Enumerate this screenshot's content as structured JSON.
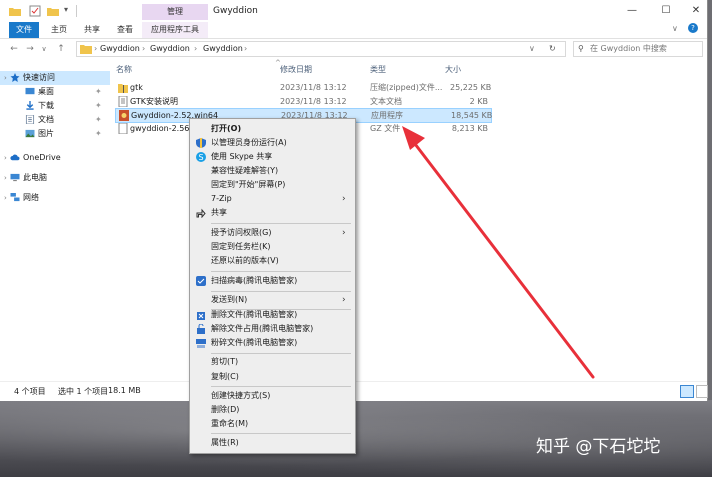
{
  "window": {
    "title": "Gwyddion",
    "context_tab_group": "管理",
    "ribbon_tabs": [
      "文件",
      "主页",
      "共享",
      "查看",
      "应用程序工具"
    ],
    "controls": {
      "minimize": "—",
      "maximize": "☐",
      "close": "✕"
    }
  },
  "address": {
    "breadcrumb": [
      "Gwyddion",
      "Gwyddion",
      "Gwyddion"
    ],
    "search_placeholder": "在 Gwyddion 中搜索"
  },
  "sidebar": {
    "items": [
      {
        "label": "快速访问",
        "icon": "star-icon",
        "pinned": false,
        "selected": true
      },
      {
        "label": "桌面",
        "icon": "desktop-icon",
        "pinned": true
      },
      {
        "label": "下载",
        "icon": "download-icon",
        "pinned": true
      },
      {
        "label": "文档",
        "icon": "document-icon",
        "pinned": true
      },
      {
        "label": "图片",
        "icon": "picture-icon",
        "pinned": true
      },
      {
        "label": "OneDrive",
        "icon": "cloud-icon"
      },
      {
        "label": "此电脑",
        "icon": "computer-icon"
      },
      {
        "label": "网络",
        "icon": "network-icon"
      }
    ]
  },
  "columns": {
    "name": "名称",
    "date": "修改日期",
    "type": "类型",
    "size": "大小"
  },
  "files": [
    {
      "name": "gtk",
      "date": "2023/11/8 13:12",
      "type": "压缩(zipped)文件...",
      "size": "25,225 KB",
      "icon": "zip-folder-icon"
    },
    {
      "name": "GTK安装说明",
      "date": "2023/11/8 13:12",
      "type": "文本文档",
      "size": "2 KB",
      "icon": "text-file-icon"
    },
    {
      "name": "Gwyddion-2.52.win64",
      "date": "2023/11/8 13:12",
      "type": "应用程序",
      "size": "18,545 KB",
      "icon": "installer-icon",
      "selected": true
    },
    {
      "name": "gwyddion-2.56.t",
      "date": "",
      "type": "GZ 文件",
      "size": "8,213 KB",
      "icon": "file-icon"
    }
  ],
  "status": {
    "count": "4 个项目",
    "selection": "选中 1 个项目",
    "size": "18.1 MB"
  },
  "context_menu": {
    "items": [
      {
        "label": "打开(O)",
        "bold": true
      },
      {
        "label": "以管理员身份运行(A)",
        "icon": "shield-icon"
      },
      {
        "label": "使用 Skype 共享",
        "icon": "skype-icon"
      },
      {
        "label": "兼容性疑难解答(Y)"
      },
      {
        "label": "固定到\"开始\"屏幕(P)"
      },
      {
        "label": "7-Zip",
        "submenu": true
      },
      {
        "label": "共享",
        "icon": "share-icon"
      },
      {
        "sep": true
      },
      {
        "label": "授予访问权限(G)",
        "submenu": true
      },
      {
        "label": "固定到任务栏(K)"
      },
      {
        "label": "还原以前的版本(V)"
      },
      {
        "sep": true
      },
      {
        "label": "扫描病毒(腾讯电脑管家)",
        "icon": "antivirus-icon"
      },
      {
        "sep": true
      },
      {
        "label": "发送到(N)",
        "submenu": true
      },
      {
        "sep": true
      },
      {
        "label": "删除文件(腾讯电脑管家)",
        "icon": "delete-tool-icon"
      },
      {
        "label": "解除文件占用(腾讯电脑管家)",
        "icon": "unlock-tool-icon"
      },
      {
        "label": "粉碎文件(腾讯电脑管家)",
        "icon": "shred-tool-icon"
      },
      {
        "sep": true
      },
      {
        "label": "剪切(T)"
      },
      {
        "label": "复制(C)"
      },
      {
        "sep": true
      },
      {
        "label": "创建快捷方式(S)"
      },
      {
        "label": "删除(D)"
      },
      {
        "label": "重命名(M)"
      },
      {
        "sep": true
      },
      {
        "label": "属性(R)"
      }
    ]
  },
  "watermark": "知乎 @下石坨坨",
  "colors": {
    "accent": "#1979ca",
    "selection": "#cce8ff",
    "arrow": "#e8303a",
    "context_tab": "#e8d7f1"
  }
}
